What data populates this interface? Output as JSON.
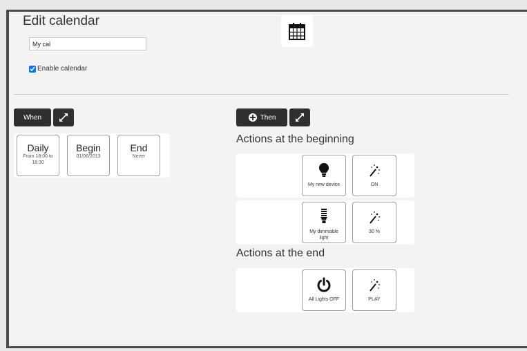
{
  "calendar": {
    "title": "Edit calendar",
    "name_value": "My cal",
    "enable_label": "Enable calendar",
    "enabled": true
  },
  "when": {
    "button_label": "When",
    "tiles": [
      {
        "title": "Daily",
        "detail": "From 18:00 to 18:30"
      },
      {
        "title": "Begin",
        "detail": "01/06/2013"
      },
      {
        "title": "End",
        "detail": "Never"
      }
    ]
  },
  "then": {
    "button_label": "Then",
    "begin_heading": "Actions at the beginning",
    "end_heading": "Actions at the end",
    "begin_actions": [
      {
        "device": "My new device",
        "device_icon": "bulb-icon",
        "state": "ON",
        "state_icon": "magic-wand-icon"
      },
      {
        "device": "My dimmable light",
        "device_icon": "cfl-bulb-icon",
        "state": "30 %",
        "state_icon": "magic-wand-icon"
      }
    ],
    "end_actions": [
      {
        "device": "All Lights OFF",
        "device_icon": "power-icon",
        "state": "PLAY",
        "state_icon": "magic-wand-icon"
      }
    ]
  }
}
